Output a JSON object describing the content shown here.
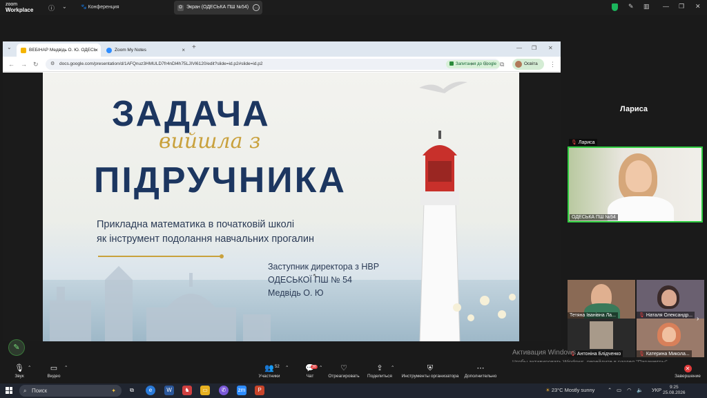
{
  "zoom_top": {
    "logo_line1": "zoom",
    "logo_line2": "Workplace",
    "info_icon": "info-icon",
    "conference_label": "Конференция",
    "share_label": "Экран (ОДЕСЬКА ПШ №54)"
  },
  "browser": {
    "tabs": [
      {
        "label": "ВЕБІНАР Медвідь О. Ю. ОДЕСЬ",
        "fav_color": "#f4b400"
      },
      {
        "label": "Zoom My Notes",
        "fav_color": "#2d8cff"
      }
    ],
    "new_tab": "+",
    "url": "docs.google.com/presentation/d/1AFQnuz3HMULD7fr4nDl4h75LJIVl6120/edit?slide=id.p2#slide=id.p2",
    "ask_google": "Запитання до Google",
    "profile_label": "Освіта"
  },
  "slide": {
    "title_top": "ЗАДАЧА",
    "title_script": "вийшла з",
    "title_bottom": "ПІДРУЧНИКА",
    "subtitle_line1": "Прикладна математика в початковій школі",
    "subtitle_line2": "як інструмент подолання навчальних прогалин",
    "author_line1": "Заступник директора з НВР",
    "author_line2": "ОДЕСЬКОЇ ПШ № 54",
    "author_line3": "Медвідь О. Ю"
  },
  "participants": {
    "speaker_name": "Лариса",
    "speaker_tile_top": "Лариса",
    "speaker_tile_bottom": "ОДЕСЬКА ПШ №54",
    "tiles": [
      {
        "name": "Тетяна Іванівна Ла..."
      },
      {
        "name": "Наталя Олександр..."
      },
      {
        "name": "Антоніна Блідченко"
      },
      {
        "name": "Катерина Микола..."
      }
    ]
  },
  "watermark": {
    "line1": "Активация Windows",
    "line2": "Чтобы активировать Windows, перейдите в раздел \"Параметры\"."
  },
  "toolbar": {
    "audio": "Звук",
    "video": "Видео",
    "participants": "Участники",
    "participants_count": "52",
    "chat": "Чат",
    "chat_badge": "30",
    "react": "Отреагировать",
    "share": "Поделиться",
    "host_tools": "Инструменты организатора",
    "more": "Дополнительно",
    "end": "Завершение"
  },
  "taskbar": {
    "search_placeholder": "Поиск",
    "weather": "23°C  Mostly sunny",
    "lang": "УКР",
    "time": "9:25",
    "date": "25.08.2026"
  },
  "colors": {
    "title_navy": "#1c3660",
    "gold": "#c9a13c",
    "active_speaker_border": "#2ecc40",
    "end_red": "#e03a3a"
  }
}
